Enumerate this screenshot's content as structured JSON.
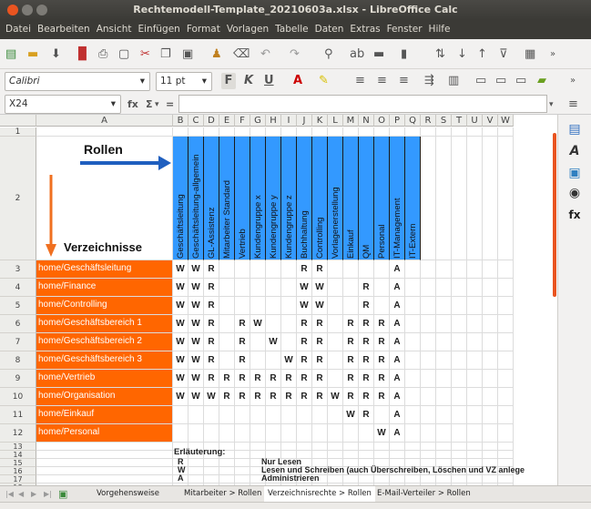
{
  "window": {
    "title": "Rechtemodell-Template_20210603a.xlsx - LibreOffice Calc"
  },
  "menu": [
    "Datei",
    "Bearbeiten",
    "Ansicht",
    "Einfügen",
    "Format",
    "Vorlagen",
    "Tabelle",
    "Daten",
    "Extras",
    "Fenster",
    "Hilfe"
  ],
  "format": {
    "font_name": "Calibri",
    "font_size": "11 pt"
  },
  "formula": {
    "cell_ref": "X24",
    "fx": "fx",
    "sigma": "Σ",
    "equals": "=",
    "value": ""
  },
  "columns": [
    "A",
    "B",
    "C",
    "D",
    "E",
    "F",
    "G",
    "H",
    "I",
    "J",
    "K",
    "L",
    "M",
    "N",
    "O",
    "P",
    "Q",
    "R",
    "S",
    "T",
    "U",
    "V",
    "W"
  ],
  "header": {
    "rollen": "Rollen",
    "verzeichnisse": "Verzeichnisse"
  },
  "roles": [
    "Geschäftsleitung",
    "Geschäftsleitung-allgemein",
    "GL-Assistenz",
    "Mitarbeiter Standard",
    "Vertrieb",
    "Kundengruppe x",
    "Kundengruppe y",
    "Kundengruppe z",
    "Buchhaltung",
    "Controlling",
    "Vorlagenerstellung",
    "Einkauf",
    "QM",
    "Personal",
    "IT-Management",
    "IT-Extern"
  ],
  "rows": [
    {
      "num": "3",
      "dir": "home/Geschäftsleitung",
      "perms": [
        "W",
        "W",
        "R",
        "",
        "",
        "",
        "",
        "",
        "R",
        "R",
        "",
        "",
        "",
        "",
        "A",
        ""
      ]
    },
    {
      "num": "4",
      "dir": "home/Finance",
      "perms": [
        "W",
        "W",
        "R",
        "",
        "",
        "",
        "",
        "",
        "W",
        "W",
        "",
        "",
        "R",
        "",
        "A",
        ""
      ]
    },
    {
      "num": "5",
      "dir": "home/Controlling",
      "perms": [
        "W",
        "W",
        "R",
        "",
        "",
        "",
        "",
        "",
        "W",
        "W",
        "",
        "",
        "R",
        "",
        "A",
        ""
      ]
    },
    {
      "num": "6",
      "dir": "home/Geschäftsbereich 1",
      "perms": [
        "W",
        "W",
        "R",
        "",
        "R",
        "W",
        "",
        "",
        "R",
        "R",
        "",
        "R",
        "R",
        "R",
        "A",
        ""
      ]
    },
    {
      "num": "7",
      "dir": "home/Geschäftsbereich 2",
      "perms": [
        "W",
        "W",
        "R",
        "",
        "R",
        "",
        "W",
        "",
        "R",
        "R",
        "",
        "R",
        "R",
        "R",
        "A",
        ""
      ]
    },
    {
      "num": "8",
      "dir": "home/Geschäftsbereich 3",
      "perms": [
        "W",
        "W",
        "R",
        "",
        "R",
        "",
        "",
        "W",
        "R",
        "R",
        "",
        "R",
        "R",
        "R",
        "A",
        ""
      ]
    },
    {
      "num": "9",
      "dir": "home/Vertrieb",
      "perms": [
        "W",
        "W",
        "R",
        "R",
        "R",
        "R",
        "R",
        "R",
        "R",
        "R",
        "",
        "R",
        "R",
        "R",
        "A",
        ""
      ]
    },
    {
      "num": "10",
      "dir": "home/Organisation",
      "perms": [
        "W",
        "W",
        "W",
        "R",
        "R",
        "R",
        "R",
        "R",
        "R",
        "R",
        "W",
        "R",
        "R",
        "R",
        "A",
        ""
      ]
    },
    {
      "num": "11",
      "dir": "home/Einkauf",
      "perms": [
        "",
        "",
        "",
        "",
        "",
        "",
        "",
        "",
        "",
        "",
        "",
        "W",
        "R",
        "",
        "A",
        ""
      ]
    },
    {
      "num": "12",
      "dir": "home/Personal",
      "perms": [
        "",
        "",
        "",
        "",
        "",
        "",
        "",
        "",
        "",
        "",
        "",
        "",
        "",
        "W",
        "A",
        ""
      ]
    }
  ],
  "legend": {
    "title": "Erläuterung:",
    "items": [
      {
        "key": "R",
        "desc": "Nur Lesen"
      },
      {
        "key": "W",
        "desc": "Lesen und Schreiben (auch Überschreiben, Löschen und VZ anlege"
      },
      {
        "key": "A",
        "desc": "Administrieren"
      }
    ]
  },
  "sheet_tabs": [
    "Vorgehensweise",
    "Mitarbeiter > Rollen",
    "Verzeichnisrechte > Rollen",
    "E-Mail-Verteiler > Rollen"
  ],
  "active_tab_index": 2,
  "extra_rows": [
    "13",
    "14",
    "15",
    "16",
    "17",
    "18"
  ]
}
